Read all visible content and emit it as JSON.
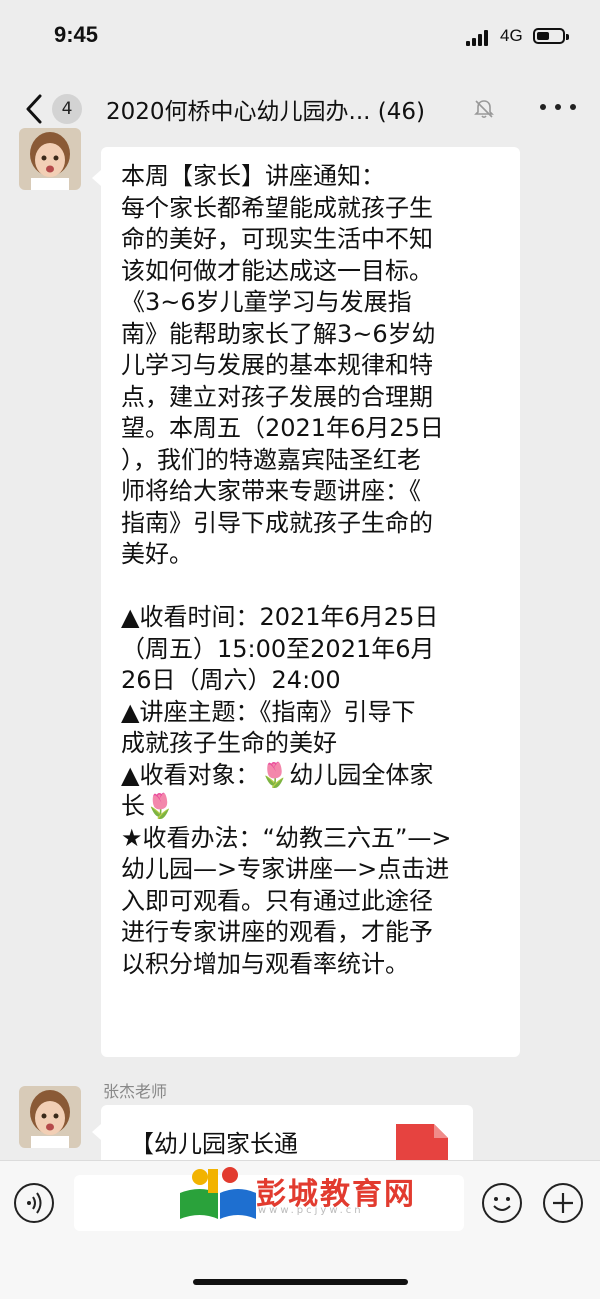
{
  "status_bar": {
    "time": "9:45",
    "network": "4G",
    "battery_level": 0.5
  },
  "nav": {
    "unread_count": "4",
    "title": "2020何桥中心幼儿园办... (46)",
    "icons": [
      "back-chevron-icon",
      "mute-bell-icon",
      "more-dots-icon"
    ]
  },
  "messages": [
    {
      "type": "text",
      "lines": [
        "本周【家长】讲座通知：",
        "每个家长都希望能成就孩子生",
        "命的美好，可现实生活中不知",
        "该如何做才能达成这一目标。",
        "《3~6岁儿童学习与发展指",
        "南》能帮助家长了解3~6岁幼",
        "儿学习与发展的基本规律和特",
        "点，建立对孩子发展的合理期",
        "望。本周五（2021年6月25日",
        "），我们的特邀嘉宾陆圣红老",
        "师将给大家带来专题讲座：《",
        "指南》引导下成就孩子生命的",
        "美好。",
        "",
        "▲收看时间：2021年6月25日",
        "（周五）15:00至2021年6月",
        "26日（周六）24:00",
        "▲讲座主题：《指南》引导下",
        "成就孩子生命的美好",
        "▲收看对象：🌷幼儿园全体家",
        "长🌷",
        "★收看办法：“幼教三六五”—>",
        "幼儿园—>专家讲座—>点击进",
        "入即可观看。只有通过此途径",
        "进行专家讲座的观看，才能予",
        "以积分增加与观看率统计。"
      ]
    },
    {
      "type": "file",
      "sender": "张杰老师",
      "file_title": "【幼儿园家长通",
      "icon": "pdf-file-icon"
    }
  ],
  "input_bar": {
    "watermark_text": "彭城教育网",
    "watermark_sub": "www.pcjyw.cn",
    "icons": [
      "voice-icon",
      "emoji-icon",
      "plus-icon"
    ]
  },
  "colors": {
    "background": "#ededed",
    "bubble": "#ffffff",
    "watermark": "#e23b2f",
    "flower": "#d6283a"
  }
}
